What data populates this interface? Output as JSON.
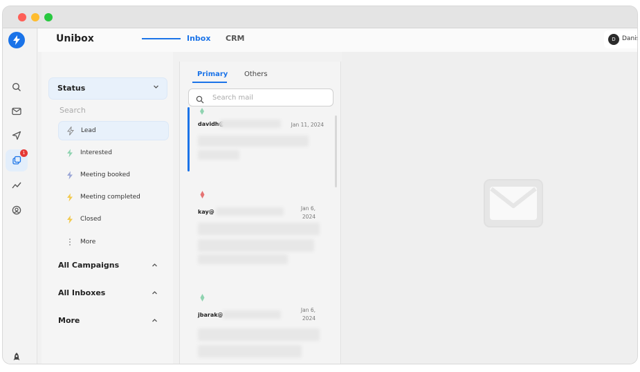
{
  "app": {
    "title": "Unibox"
  },
  "topbar": {
    "tabs": [
      {
        "label": "Inbox"
      },
      {
        "label": "CRM"
      }
    ]
  },
  "user": {
    "initial": "D",
    "name": "Danis"
  },
  "rail": {
    "notification_count": "1"
  },
  "filters": {
    "status_title": "Status",
    "search_label": "Search",
    "statuses": [
      {
        "label": "Lead",
        "icon": "bolt-outline-icon",
        "color": "#888888"
      },
      {
        "label": "Interested",
        "icon": "bolt-icon",
        "color": "#8fd3b0"
      },
      {
        "label": "Meeting booked",
        "icon": "bolt-icon",
        "color": "#9aa6d6"
      },
      {
        "label": "Meeting completed",
        "icon": "bolt-icon",
        "color": "#f2c94c"
      },
      {
        "label": "Closed",
        "icon": "bolt-icon",
        "color": "#f2c94c"
      },
      {
        "label": "More",
        "icon": "more-vertical-icon",
        "color": "#999999"
      }
    ],
    "groups": [
      {
        "label": "All Campaigns"
      },
      {
        "label": "All Inboxes"
      },
      {
        "label": "More"
      }
    ]
  },
  "mail_list": {
    "subtabs": [
      {
        "label": "Primary"
      },
      {
        "label": "Others"
      }
    ],
    "search_placeholder": "Search mail",
    "items": [
      {
        "sender": "davidh@",
        "date": "Jan 11, 2024",
        "flag_color": "#8fd3b0"
      },
      {
        "sender": "kay@",
        "date_line1": "Jan 6,",
        "date_line2": "2024",
        "flag_color": "#e57373"
      },
      {
        "sender": "jbarak@",
        "date_line1": "Jan 6,",
        "date_line2": "2024",
        "flag_color": "#8fd3b0"
      }
    ]
  },
  "colors": {
    "accent": "#1a73e8",
    "badge": "#e53935"
  }
}
